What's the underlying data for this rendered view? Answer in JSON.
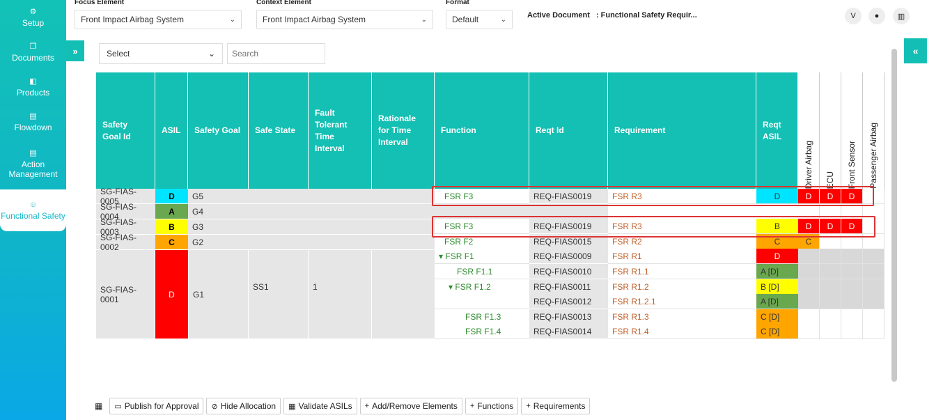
{
  "sidebar": [
    {
      "icon": "⚙",
      "label": "Setup"
    },
    {
      "icon": "❐",
      "label": "Documents"
    },
    {
      "icon": "◧",
      "label": "Products"
    },
    {
      "icon": "▤",
      "label": "Flowdown"
    },
    {
      "icon": "▤",
      "label": "Action Management"
    },
    {
      "icon": "☺",
      "label": "Functional Safety"
    }
  ],
  "topbar": {
    "focus_label": "Focus Element",
    "focus_value": "Front Impact Airbag System",
    "context_label": "Context Element",
    "context_value": "Front Impact Airbag System",
    "format_label": "Format",
    "format_value": "Default",
    "active_doc_label": "Active Document",
    "active_doc_value": ": Functional Safety Requir...",
    "btn1": "V",
    "btn2": "●",
    "btn3": "▥"
  },
  "filter": {
    "select": "Select",
    "search_placeholder": "Search"
  },
  "expand_left": "»",
  "expand_right": "«",
  "headers": {
    "sg_id": "Safety Goal Id",
    "asil": "ASIL",
    "sg": "Safety Goal",
    "safe_state": "Safe State",
    "ftti": "Fault Tolerant Time Interval",
    "rationale": "Rationale for Time Interval",
    "function": "Function",
    "reqt_id": "Reqt Id",
    "requirement": "Requirement",
    "reqt_asil": "Reqt ASIL",
    "alloc": [
      "Driver Airbag",
      "ECU",
      "Front Sensor",
      "Passenger Airbag"
    ]
  },
  "goals": [
    {
      "id": "SG-FIAS-0005",
      "asil": "D",
      "asil_color": "#00e5ff",
      "asil_text": "#000",
      "goal": "G5"
    },
    {
      "id": "SG-FIAS-0004",
      "asil": "A",
      "asil_color": "#6aa84f",
      "asil_text": "#000",
      "goal": "G4"
    },
    {
      "id": "SG-FIAS-0003",
      "asil": "B",
      "asil_color": "#ffff00",
      "asil_text": "#000",
      "goal": "G3"
    },
    {
      "id": "SG-FIAS-0002",
      "asil": "C",
      "asil_color": "#ffa500",
      "asil_text": "#000",
      "goal": "G2"
    },
    {
      "id": "SG-FIAS-0001",
      "asil": "D",
      "asil_color": "#ff0000",
      "asil_text": "#fff",
      "goal": "G1",
      "safe_state": "SS1",
      "ftti": "1"
    }
  ],
  "reqs": [
    {
      "fn": "FSR F3",
      "id": "REQ-FIAS0019",
      "req": "FSR R3",
      "asil": "D",
      "asil_color": "#00e5ff",
      "alloc": [
        "D",
        "D",
        "D",
        ""
      ]
    },
    {
      "fn": "",
      "id": "",
      "req": "",
      "asil": "",
      "asil_color": "",
      "alloc": [
        "",
        "",
        "",
        ""
      ]
    },
    {
      "fn": "FSR F3",
      "id": "REQ-FIAS0019",
      "req": "FSR R3",
      "asil": "B",
      "asil_color": "#ffff00",
      "alloc": [
        "D",
        "D",
        "D",
        ""
      ]
    },
    {
      "fn": "FSR F2",
      "id": "REQ-FIAS0015",
      "req": "FSR R2",
      "asil": "C",
      "asil_color": "#ffa500",
      "alloc": [
        "C",
        "",
        "",
        ""
      ]
    },
    {
      "fn": "▾ FSR F1",
      "id": "REQ-FIAS0009",
      "req": "FSR R1",
      "asil": "D",
      "asil_color": "#ff0000",
      "alloc": [
        "",
        "",
        "",
        ""
      ]
    },
    {
      "fn": "FSR F1.1",
      "id": "REQ-FIAS0010",
      "req": "FSR R1.1",
      "asil": "A [D]",
      "asil_color": "#6aa84f",
      "alloc": [
        "",
        "",
        "",
        ""
      ]
    },
    {
      "fn": "▾ FSR F1.2",
      "id": "REQ-FIAS0011",
      "req": "FSR R1.2",
      "asil": "B [D]",
      "asil_color": "#ffff00",
      "alloc": [
        "",
        "",
        "",
        ""
      ]
    },
    {
      "fn": "",
      "id": "REQ-FIAS0012",
      "req": "FSR R1.2.1",
      "asil": "A [D]",
      "asil_color": "#6aa84f",
      "alloc": [
        "",
        "",
        "",
        ""
      ]
    },
    {
      "fn": "FSR F1.3",
      "id": "REQ-FIAS0013",
      "req": "FSR R1.3",
      "asil": "C [D]",
      "asil_color": "#ffa500",
      "alloc": [
        "",
        "",
        "",
        ""
      ]
    },
    {
      "fn": "FSR F1.4",
      "id": "REQ-FIAS0014",
      "req": "FSR R1.4",
      "asil": "C [D]",
      "asil_color": "#ffa500",
      "alloc": [
        "",
        "",
        "",
        ""
      ]
    }
  ],
  "toolbar": {
    "grid": "▦",
    "publish": "Publish for Approval",
    "hide": "Hide Allocation",
    "validate": "Validate ASILs",
    "add_remove": "Add/Remove Elements",
    "functions": "Functions",
    "requirements": "Requirements"
  }
}
